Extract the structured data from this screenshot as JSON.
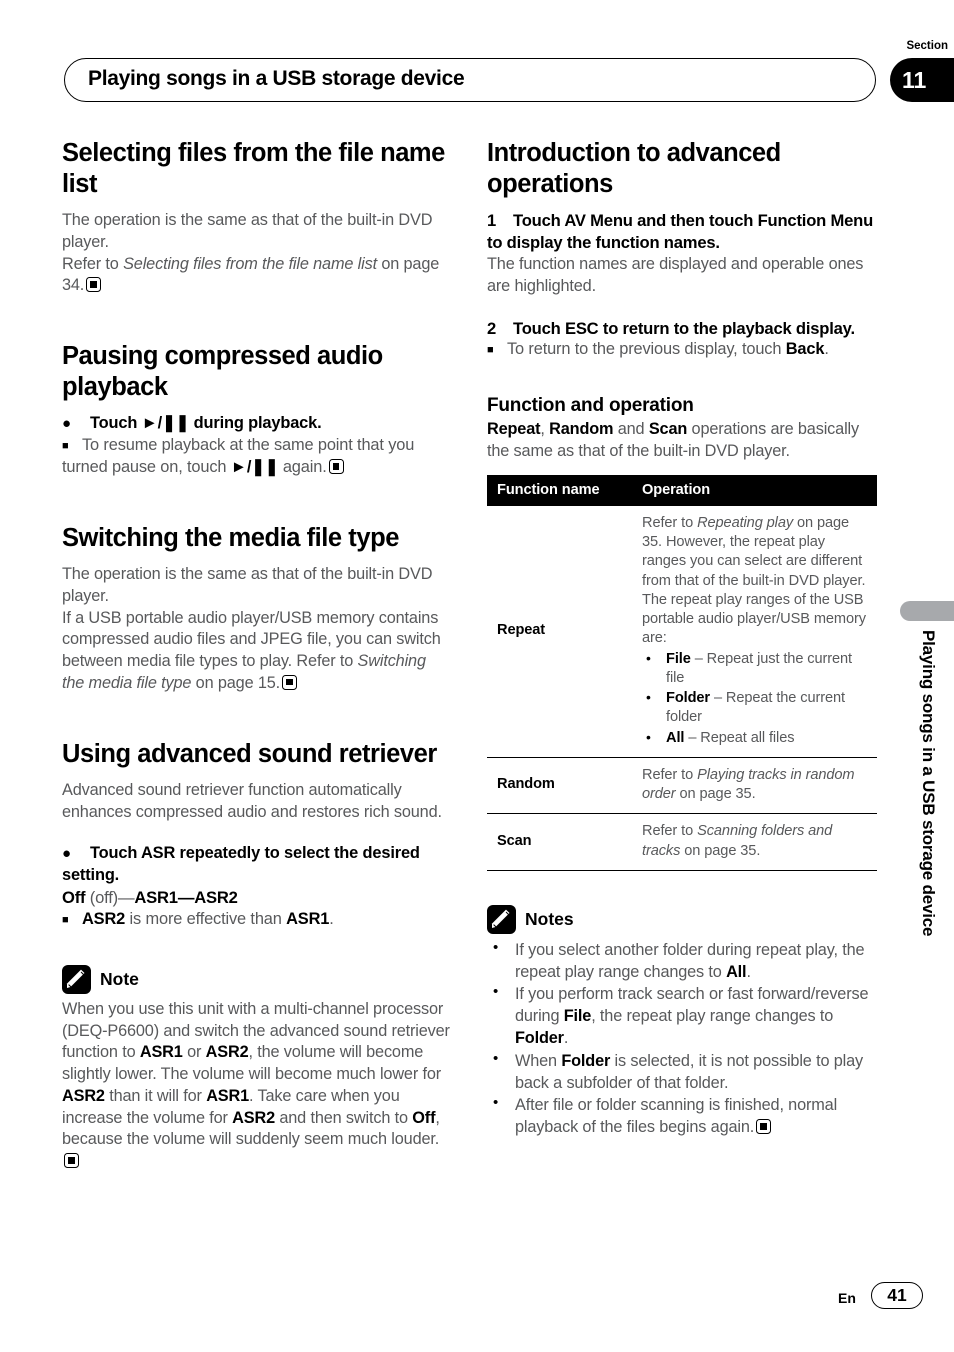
{
  "header": {
    "title": "Playing songs in a USB storage device",
    "section_label": "Section",
    "section_number": "11"
  },
  "side_tab": {
    "vertical_text": "Playing songs in a USB storage device"
  },
  "footer": {
    "language": "En",
    "page_number": "41"
  },
  "left_column": {
    "topic1": {
      "heading": "Selecting files from the file name list",
      "para1": "The operation is the same as that of the built-in DVD player.",
      "para2_prefix": "Refer to ",
      "para2_italic": "Selecting files from the file name list",
      "para2_suffix": " on page 34."
    },
    "topic2": {
      "heading": "Pausing compressed audio playback",
      "bullet_dot": "Touch ►/❚❚ during playback.",
      "bullet_sq_a": "To resume playback at the same point that you turned pause on, touch ",
      "bullet_sq_glyph": "►/❚❚",
      "bullet_sq_b": " again."
    },
    "topic3": {
      "heading": "Switching the media file type",
      "para1": "The operation is the same as that of the built-in DVD player.",
      "para2_a": "If a USB portable audio player/USB memory contains compressed audio files and JPEG file, you can switch between media file types to play. Refer to ",
      "para2_italic": "Switching the media file type",
      "para2_b": " on page 15."
    },
    "topic4": {
      "heading": "Using advanced sound retriever",
      "para1": "Advanced sound retriever function automatically enhances compressed audio and restores rich sound.",
      "bullet_dot": "Touch ASR repeatedly to select the desired setting.",
      "settings_bold1": "Off",
      "settings_plain1": " (off)—",
      "settings_bold2": "ASR1",
      "settings_plain2": "—",
      "settings_bold3": "ASR2",
      "bullet_sq_b1": "ASR2",
      "bullet_sq_t1": " is more effective than ",
      "bullet_sq_b2": "ASR1",
      "bullet_sq_t2": "."
    },
    "note": {
      "icon": "pencil-icon",
      "title": "Note",
      "text_1": "When you use this unit with a multi-channel processor (DEQ-P6600) and switch the advanced sound retriever function to ",
      "bold_1": "ASR1",
      "text_2": " or ",
      "bold_2": "ASR2",
      "text_3": ", the volume will become slightly lower. The volume will become much lower for ",
      "bold_3": "ASR2",
      "text_4": " than it will for ",
      "bold_4": "ASR1",
      "text_5": ". Take care when you increase the volume for ",
      "bold_5": "ASR2",
      "text_6": " and then switch to ",
      "bold_6": "Off",
      "text_7": ", because the volume will suddenly seem much louder."
    }
  },
  "right_column": {
    "topic1": {
      "heading": "Introduction to advanced operations",
      "step1_num": "1",
      "step1_text": "Touch AV Menu and then touch Function Menu to display the function names.",
      "step1_body": "The function names are displayed and operable ones are highlighted.",
      "step2_num": "2",
      "step2_text": "Touch ESC to return to the playback display.",
      "step2_bullet_a": "To return to the previous display, touch ",
      "step2_bullet_bold": "Back",
      "step2_bullet_b": "."
    },
    "function_section": {
      "heading": "Function and operation",
      "intro_b1": "Repeat",
      "intro_t1": ", ",
      "intro_b2": "Random",
      "intro_t2": " and ",
      "intro_b3": "Scan",
      "intro_t3": " operations are basically the same as that of the built-in DVD player."
    },
    "table": {
      "columns": [
        "Function name",
        "Operation"
      ],
      "rows": [
        {
          "name": "Repeat",
          "op_prefix": "Refer to ",
          "op_italic": "Repeating play",
          "op_suffix": " on page 35. However, the repeat play ranges you can select are different from that of the built-in DVD player. The repeat play ranges of the USB portable audio player/USB memory are:",
          "sub_bullets": [
            {
              "bold": "File",
              "text": " – Repeat just the current file"
            },
            {
              "bold": "Folder",
              "text": " – Repeat the current folder"
            },
            {
              "bold": "All",
              "text": " – Repeat all files"
            }
          ]
        },
        {
          "name": "Random",
          "op_prefix": "Refer to ",
          "op_italic": "Playing tracks in random order",
          "op_suffix": " on page 35.",
          "sub_bullets": []
        },
        {
          "name": "Scan",
          "op_prefix": "Refer to ",
          "op_italic": "Scanning folders and tracks",
          "op_suffix": " on page 35.",
          "sub_bullets": []
        }
      ]
    },
    "notes": {
      "icon": "pencil-icon",
      "title": "Notes",
      "items": [
        {
          "t1": "If you select another folder during repeat play, the repeat play range changes to ",
          "b1": "All",
          "t2": "."
        },
        {
          "t1": "If you perform track search or fast forward/reverse during ",
          "b1": "File",
          "t2": ", the repeat play range changes to ",
          "b2": "Folder",
          "t3": "."
        },
        {
          "t1": "When ",
          "b1": "Folder",
          "t2": " is selected, it is not possible to play back a subfolder of that folder."
        },
        {
          "t1": "After file or folder scanning is finished, normal playback of the files begins again."
        }
      ]
    }
  },
  "colors": {
    "body_text": "#58595b",
    "heading_text": "#000000",
    "table_header_bg": "#000000",
    "side_tab": "#a7a9ac"
  }
}
